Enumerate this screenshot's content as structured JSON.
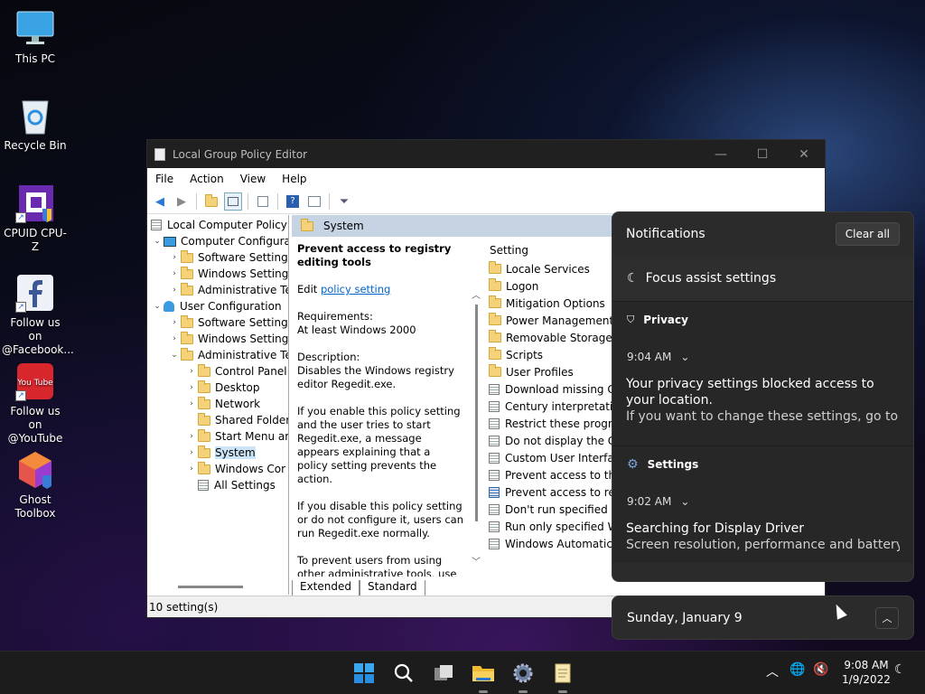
{
  "desktop": {
    "icons": [
      {
        "label": "This PC"
      },
      {
        "label": "Recycle Bin"
      },
      {
        "label": "CPUID CPU-Z"
      },
      {
        "label": "Follow us on @Facebook..."
      },
      {
        "label": "Follow us on @YouTube ..."
      },
      {
        "label": "Ghost Toolbox"
      }
    ]
  },
  "window": {
    "title": "Local Group Policy Editor",
    "controls": {
      "minimize": "—",
      "maximize": "☐",
      "close": "✕"
    },
    "menu": [
      "File",
      "Action",
      "View",
      "Help"
    ],
    "tree": [
      {
        "label": "Local Computer Policy"
      },
      {
        "label": "Computer Configura"
      },
      {
        "label": "Software Settings"
      },
      {
        "label": "Windows Setting"
      },
      {
        "label": "Administrative Te"
      },
      {
        "label": "User Configuration"
      },
      {
        "label": "Software Settings"
      },
      {
        "label": "Windows Setting"
      },
      {
        "label": "Administrative Te"
      },
      {
        "label": "Control Panel"
      },
      {
        "label": "Desktop"
      },
      {
        "label": "Network"
      },
      {
        "label": "Shared Folder"
      },
      {
        "label": "Start Menu ar"
      },
      {
        "label": "System"
      },
      {
        "label": "Windows Cor"
      },
      {
        "label": "All Settings"
      }
    ],
    "content_header": "System",
    "description": {
      "title": "Prevent access to registry editing tools",
      "edit_prefix": "Edit",
      "edit_link": "policy setting",
      "requirements_label": "Requirements:",
      "requirements_value": "At least Windows 2000",
      "description_label": "Description:",
      "description_text": "Disables the Windows registry editor Regedit.exe.",
      "p_enable": "If you enable this policy setting and the user tries to start Regedit.exe, a message appears explaining that a policy setting prevents the action.",
      "p_disable": "If you disable this policy setting or do not configure it, users can run Regedit.exe normally.",
      "p_prevent": "To prevent users from using other administrative tools, use the \"Run only specified Windows"
    },
    "list_header": "Setting",
    "settings": [
      {
        "label": "Locale Services",
        "kind": "folder"
      },
      {
        "label": "Logon",
        "kind": "folder"
      },
      {
        "label": "Mitigation Options",
        "kind": "folder"
      },
      {
        "label": "Power Management",
        "kind": "folder"
      },
      {
        "label": "Removable Storage Ac",
        "kind": "folder"
      },
      {
        "label": "Scripts",
        "kind": "folder"
      },
      {
        "label": "User Profiles",
        "kind": "folder"
      },
      {
        "label": "Download missing CO",
        "kind": "policy"
      },
      {
        "label": "Century interpretation",
        "kind": "policy"
      },
      {
        "label": "Restrict these program",
        "kind": "policy"
      },
      {
        "label": "Do not display the Gett",
        "kind": "policy"
      },
      {
        "label": "Custom User Interface",
        "kind": "policy"
      },
      {
        "label": "Prevent access to the c",
        "kind": "policy"
      },
      {
        "label": "Prevent access to regis",
        "kind": "policy",
        "selected": true
      },
      {
        "label": "Don't run specified Win",
        "kind": "policy"
      },
      {
        "label": "Run only specified Win",
        "kind": "policy"
      },
      {
        "label": "Windows Automatic U",
        "kind": "policy"
      }
    ],
    "tabs": [
      "Extended",
      "Standard"
    ],
    "status": "10 setting(s)"
  },
  "notifications": {
    "title": "Notifications",
    "clear_all": "Clear all",
    "focus_assist": "Focus assist settings",
    "groups": [
      {
        "app": "Privacy",
        "time": "9:04 AM",
        "heading": "Your privacy settings blocked access to your location.",
        "body": "If you want to change these settings, go to Settin"
      },
      {
        "app": "Settings",
        "time": "9:02 AM",
        "heading": "Searching for Display Driver",
        "body": "Screen resolution, performance and battery life m"
      }
    ]
  },
  "calendar": {
    "date": "Sunday, January 9"
  },
  "taskbar": {
    "apps": [
      "start-icon",
      "search-icon",
      "task-view-icon",
      "file-explorer-icon",
      "settings-icon",
      "notepad-icon"
    ],
    "time": "9:08 AM",
    "date": "1/9/2022"
  }
}
